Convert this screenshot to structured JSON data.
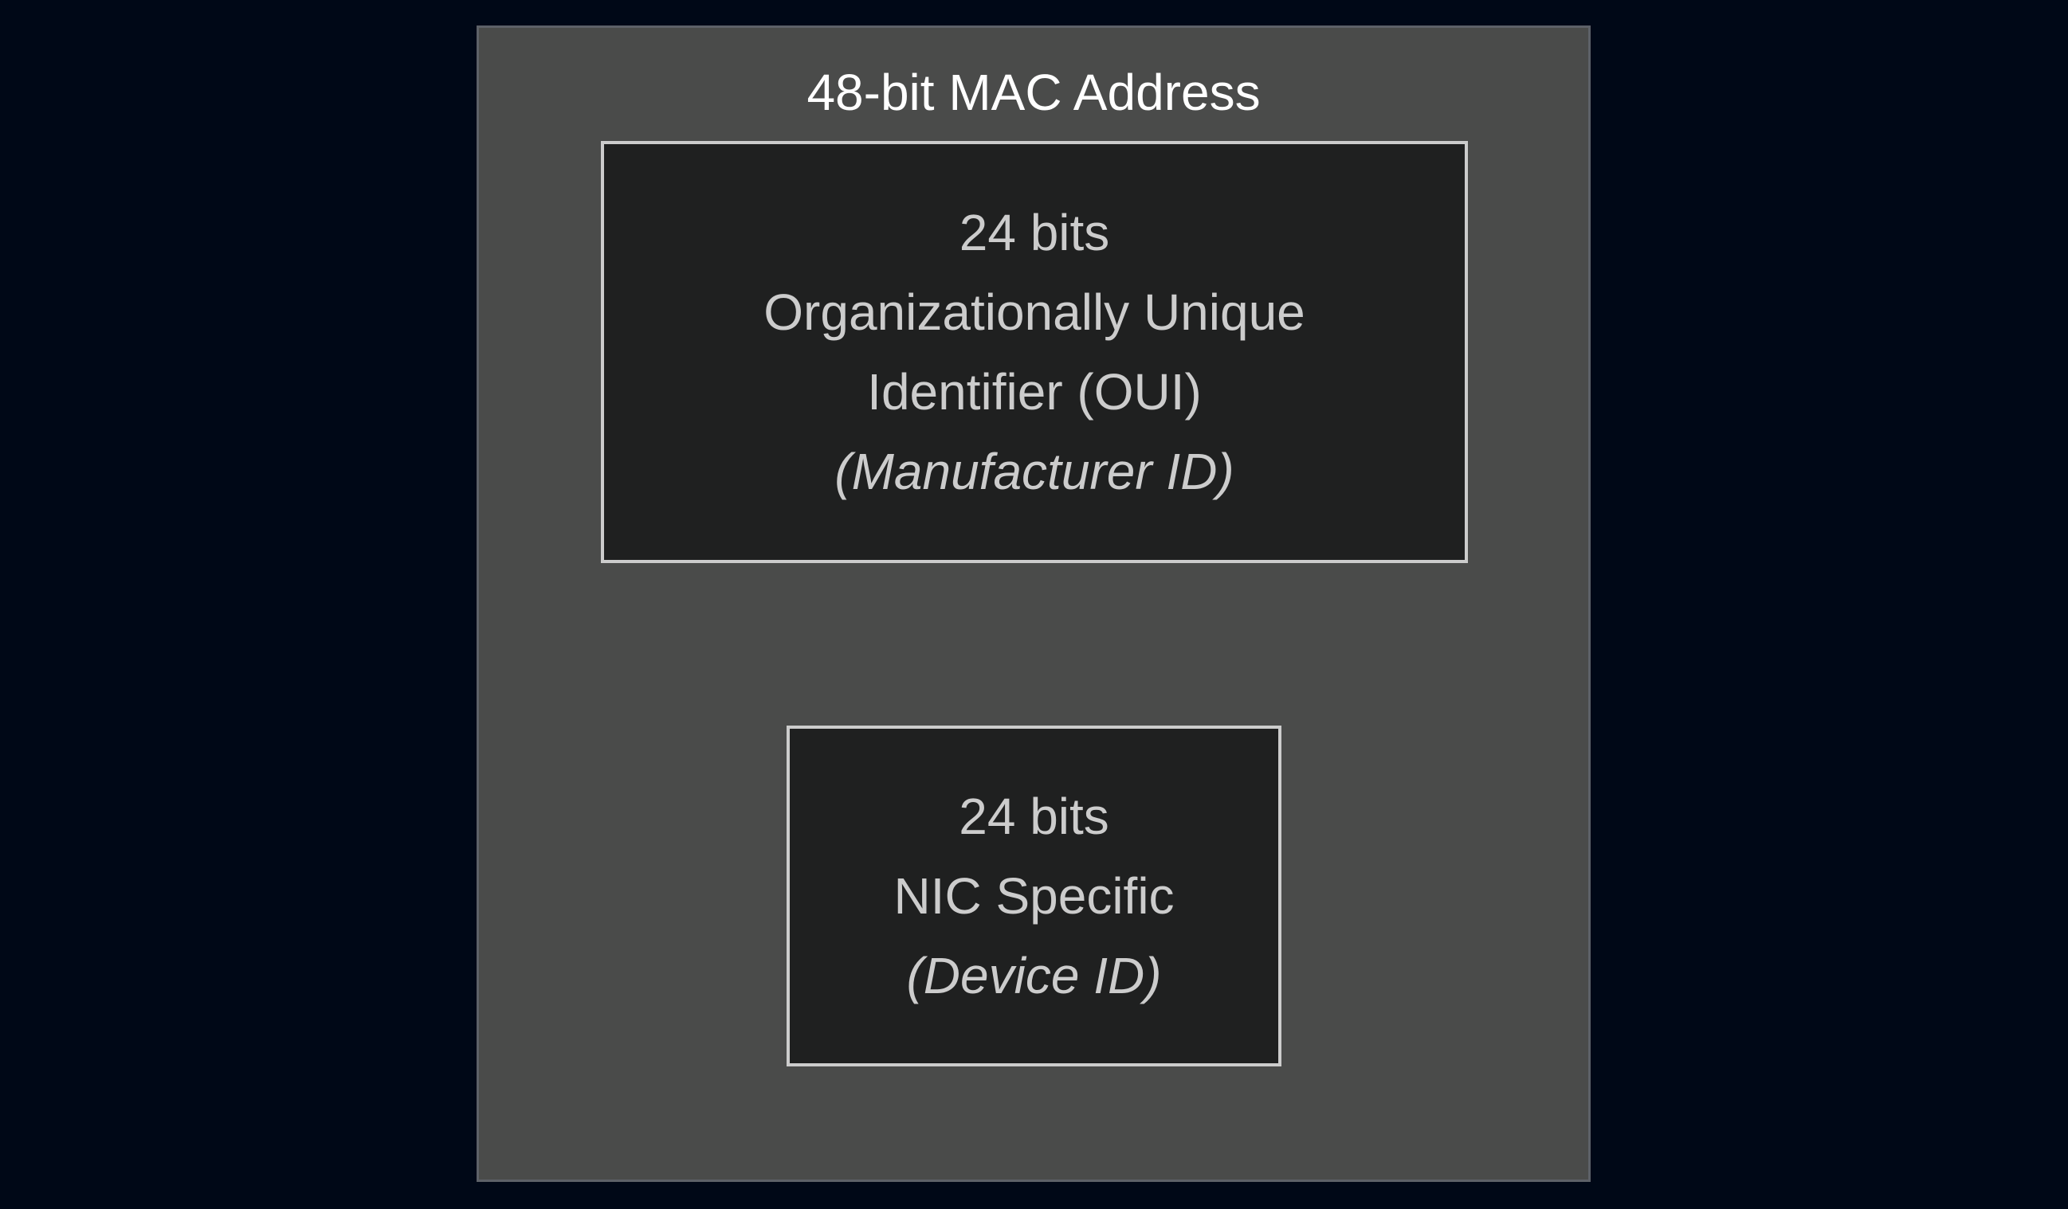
{
  "colors": {
    "background": "#000817",
    "outer_fill": "#4a4b4a",
    "outer_border": "#5d6168",
    "inner_fill": "#1f2020",
    "inner_border": "#cccccc",
    "title_text": "#ffffff",
    "inner_text": "#cccccc"
  },
  "diagram": {
    "title": "48-bit MAC Address",
    "oui": {
      "bits": "24 bits",
      "line1": "Organizationally Unique",
      "line2": "Identifier (OUI)",
      "note": "(Manufacturer ID)"
    },
    "nic": {
      "bits": "24 bits",
      "line1": "NIC Specific",
      "note": "(Device ID)"
    }
  }
}
